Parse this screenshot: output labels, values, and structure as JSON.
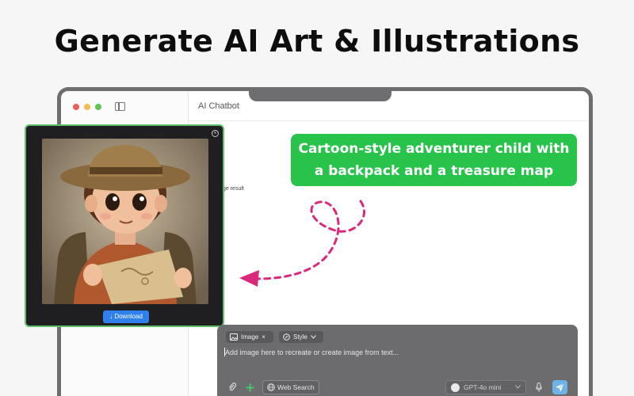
{
  "headline": "Generate AI Art & Illustrations",
  "window": {
    "title": "AI Chatbot"
  },
  "result_hint": "ge result",
  "prompt_bubble": {
    "line1": "Cartoon-style adventurer child with",
    "line2": "a backpack and a treasure map"
  },
  "preview": {
    "download_label": "Download"
  },
  "composer": {
    "chip_image": "Image",
    "chip_style": "Style",
    "placeholder": "Add image here to recreate or create image from text...",
    "web_search": "Web Search",
    "model": "GPT-4o mini"
  },
  "colors": {
    "bubble": "#27c34a",
    "popup_border": "#5fbf6a",
    "arrow": "#d9297a",
    "download": "#2f80ed",
    "send": "#6fb3e6"
  },
  "icons": [
    "sidebar-toggle-icon",
    "close-icon",
    "image-icon",
    "style-icon",
    "attach-icon",
    "plus-icon",
    "globe-icon",
    "chevron-down-icon",
    "mic-icon",
    "send-icon",
    "download-icon"
  ]
}
